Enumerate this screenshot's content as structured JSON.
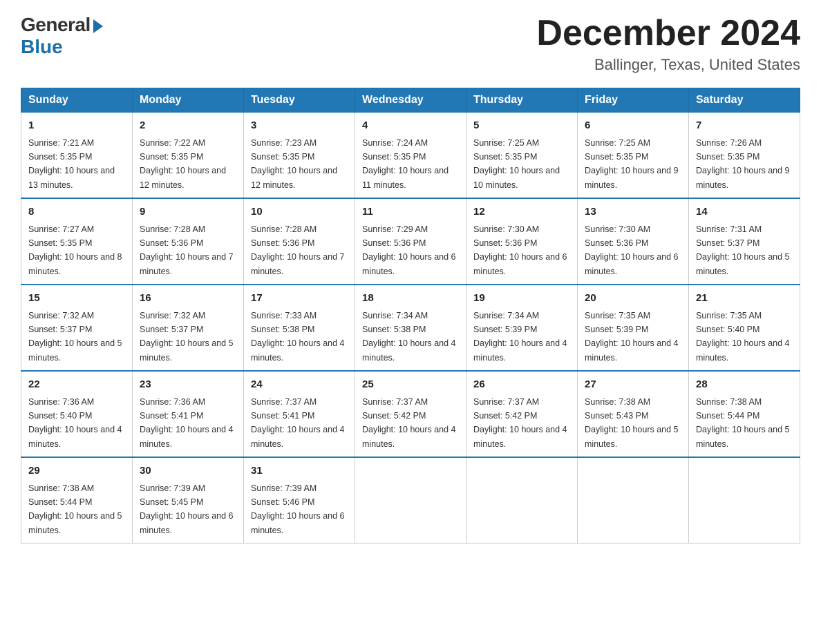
{
  "logo": {
    "general": "General",
    "blue": "Blue"
  },
  "title": "December 2024",
  "location": "Ballinger, Texas, United States",
  "days_of_week": [
    "Sunday",
    "Monday",
    "Tuesday",
    "Wednesday",
    "Thursday",
    "Friday",
    "Saturday"
  ],
  "weeks": [
    [
      {
        "day": "1",
        "sunrise": "7:21 AM",
        "sunset": "5:35 PM",
        "daylight": "10 hours and 13 minutes."
      },
      {
        "day": "2",
        "sunrise": "7:22 AM",
        "sunset": "5:35 PM",
        "daylight": "10 hours and 12 minutes."
      },
      {
        "day": "3",
        "sunrise": "7:23 AM",
        "sunset": "5:35 PM",
        "daylight": "10 hours and 12 minutes."
      },
      {
        "day": "4",
        "sunrise": "7:24 AM",
        "sunset": "5:35 PM",
        "daylight": "10 hours and 11 minutes."
      },
      {
        "day": "5",
        "sunrise": "7:25 AM",
        "sunset": "5:35 PM",
        "daylight": "10 hours and 10 minutes."
      },
      {
        "day": "6",
        "sunrise": "7:25 AM",
        "sunset": "5:35 PM",
        "daylight": "10 hours and 9 minutes."
      },
      {
        "day": "7",
        "sunrise": "7:26 AM",
        "sunset": "5:35 PM",
        "daylight": "10 hours and 9 minutes."
      }
    ],
    [
      {
        "day": "8",
        "sunrise": "7:27 AM",
        "sunset": "5:35 PM",
        "daylight": "10 hours and 8 minutes."
      },
      {
        "day": "9",
        "sunrise": "7:28 AM",
        "sunset": "5:36 PM",
        "daylight": "10 hours and 7 minutes."
      },
      {
        "day": "10",
        "sunrise": "7:28 AM",
        "sunset": "5:36 PM",
        "daylight": "10 hours and 7 minutes."
      },
      {
        "day": "11",
        "sunrise": "7:29 AM",
        "sunset": "5:36 PM",
        "daylight": "10 hours and 6 minutes."
      },
      {
        "day": "12",
        "sunrise": "7:30 AM",
        "sunset": "5:36 PM",
        "daylight": "10 hours and 6 minutes."
      },
      {
        "day": "13",
        "sunrise": "7:30 AM",
        "sunset": "5:36 PM",
        "daylight": "10 hours and 6 minutes."
      },
      {
        "day": "14",
        "sunrise": "7:31 AM",
        "sunset": "5:37 PM",
        "daylight": "10 hours and 5 minutes."
      }
    ],
    [
      {
        "day": "15",
        "sunrise": "7:32 AM",
        "sunset": "5:37 PM",
        "daylight": "10 hours and 5 minutes."
      },
      {
        "day": "16",
        "sunrise": "7:32 AM",
        "sunset": "5:37 PM",
        "daylight": "10 hours and 5 minutes."
      },
      {
        "day": "17",
        "sunrise": "7:33 AM",
        "sunset": "5:38 PM",
        "daylight": "10 hours and 4 minutes."
      },
      {
        "day": "18",
        "sunrise": "7:34 AM",
        "sunset": "5:38 PM",
        "daylight": "10 hours and 4 minutes."
      },
      {
        "day": "19",
        "sunrise": "7:34 AM",
        "sunset": "5:39 PM",
        "daylight": "10 hours and 4 minutes."
      },
      {
        "day": "20",
        "sunrise": "7:35 AM",
        "sunset": "5:39 PM",
        "daylight": "10 hours and 4 minutes."
      },
      {
        "day": "21",
        "sunrise": "7:35 AM",
        "sunset": "5:40 PM",
        "daylight": "10 hours and 4 minutes."
      }
    ],
    [
      {
        "day": "22",
        "sunrise": "7:36 AM",
        "sunset": "5:40 PM",
        "daylight": "10 hours and 4 minutes."
      },
      {
        "day": "23",
        "sunrise": "7:36 AM",
        "sunset": "5:41 PM",
        "daylight": "10 hours and 4 minutes."
      },
      {
        "day": "24",
        "sunrise": "7:37 AM",
        "sunset": "5:41 PM",
        "daylight": "10 hours and 4 minutes."
      },
      {
        "day": "25",
        "sunrise": "7:37 AM",
        "sunset": "5:42 PM",
        "daylight": "10 hours and 4 minutes."
      },
      {
        "day": "26",
        "sunrise": "7:37 AM",
        "sunset": "5:42 PM",
        "daylight": "10 hours and 4 minutes."
      },
      {
        "day": "27",
        "sunrise": "7:38 AM",
        "sunset": "5:43 PM",
        "daylight": "10 hours and 5 minutes."
      },
      {
        "day": "28",
        "sunrise": "7:38 AM",
        "sunset": "5:44 PM",
        "daylight": "10 hours and 5 minutes."
      }
    ],
    [
      {
        "day": "29",
        "sunrise": "7:38 AM",
        "sunset": "5:44 PM",
        "daylight": "10 hours and 5 minutes."
      },
      {
        "day": "30",
        "sunrise": "7:39 AM",
        "sunset": "5:45 PM",
        "daylight": "10 hours and 6 minutes."
      },
      {
        "day": "31",
        "sunrise": "7:39 AM",
        "sunset": "5:46 PM",
        "daylight": "10 hours and 6 minutes."
      },
      null,
      null,
      null,
      null
    ]
  ]
}
